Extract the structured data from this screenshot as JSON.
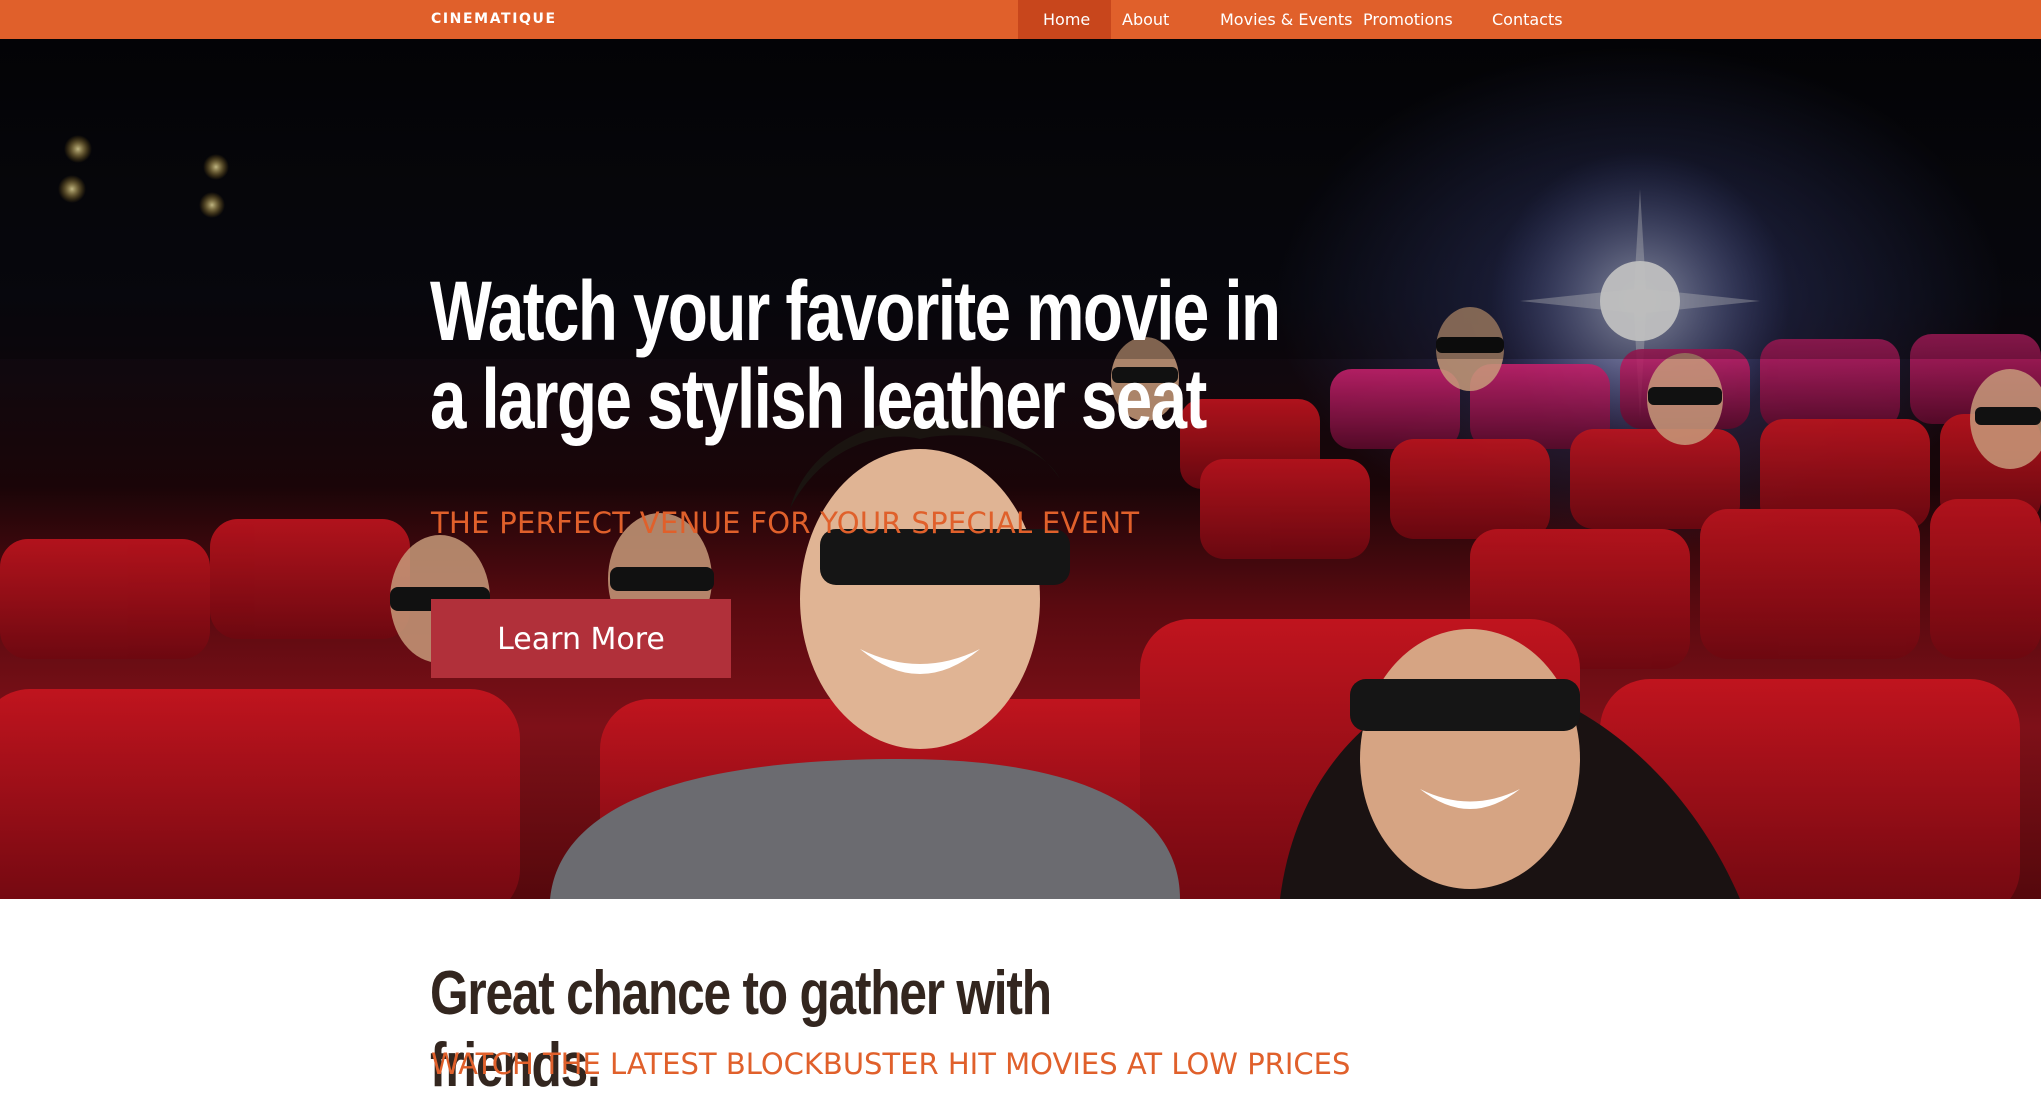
{
  "header": {
    "logo": "CINEMATIQUE",
    "nav": [
      {
        "label": "Home",
        "active": true
      },
      {
        "label": "About"
      },
      {
        "label": "Movies & Events"
      },
      {
        "label": "Promotions"
      },
      {
        "label": "Contacts"
      }
    ]
  },
  "hero": {
    "title": "Watch your favorite movie in a large stylish leather seat",
    "subtitle": "THE PERFECT VENUE FOR YOUR SPECIAL EVENT",
    "cta_label": "Learn More"
  },
  "section": {
    "title": "Great chance to gather with friends.",
    "subtitle": "WATCH THE LATEST BLOCKBUSTER HIT MOVIES AT LOW PRICES"
  },
  "colors": {
    "accent": "#e0602b",
    "nav_active": "#c8461c",
    "button": "#b1303a",
    "heading_dark": "#33261f"
  }
}
